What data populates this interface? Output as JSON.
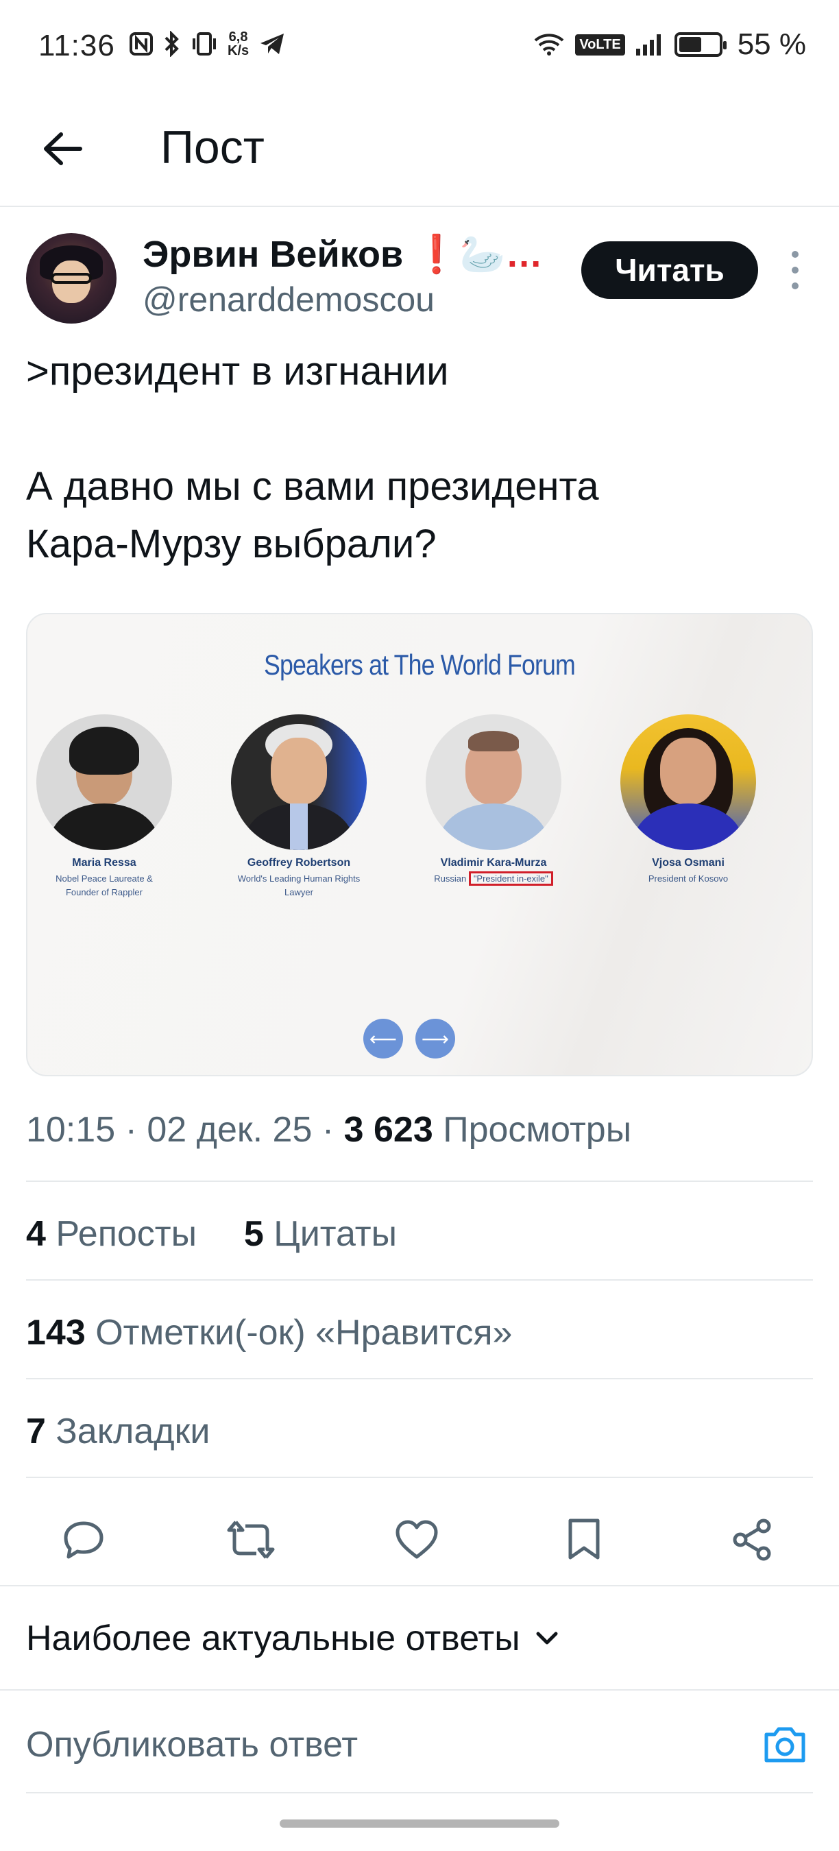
{
  "status_bar": {
    "time": "11:36",
    "speed_value": "6,8",
    "speed_unit": "K/s",
    "volte": "VoLTE",
    "battery_percent": "55 %"
  },
  "header": {
    "title": "Пост"
  },
  "author": {
    "name": "Эрвин Вейков",
    "badge": "❗🦢…",
    "handle": "@renarddemoscou"
  },
  "follow_label": "Читать",
  "tweet": {
    "line1": ">президент в изгнании",
    "line2": "А давно мы с вами президента",
    "line3": "Кара-Мурзу выбрали?"
  },
  "media": {
    "title": "Speakers at The World Forum",
    "speakers": [
      {
        "name": "Maria Ressa",
        "role_line1": "Nobel Peace Laureate &",
        "role_line2": "Founder of Rappler"
      },
      {
        "name": "Geoffrey Robertson",
        "role_line1": "World's Leading Human Rights",
        "role_line2": "Lawyer"
      },
      {
        "name": "Vladimir Kara-Murza",
        "role_prefix": "Russian ",
        "role_highlight": "\"President in-exile\""
      },
      {
        "name": "Vjosa Osmani",
        "role_line1": "President of Kosovo"
      }
    ],
    "prev_arrow": "⟵",
    "next_arrow": "⟶"
  },
  "meta": {
    "time": "10:15",
    "date": "02 дек. 25",
    "views_count": "3 623",
    "views_label": "Просмотры"
  },
  "stats": {
    "reposts_count": "4",
    "reposts_label": "Репосты",
    "quotes_count": "5",
    "quotes_label": "Цитаты",
    "likes_count": "143",
    "likes_label": "Отметки(-ок) «Нравится»",
    "bookmarks_count": "7",
    "bookmarks_label": "Закладки"
  },
  "replies": {
    "sort_label": "Наиболее актуальные ответы",
    "input_placeholder": "Опубликовать ответ"
  },
  "colors": {
    "accent": "#1d9bf0",
    "text": "#0f1419",
    "secondary": "#536471",
    "highlight_red": "#d11f2a"
  }
}
